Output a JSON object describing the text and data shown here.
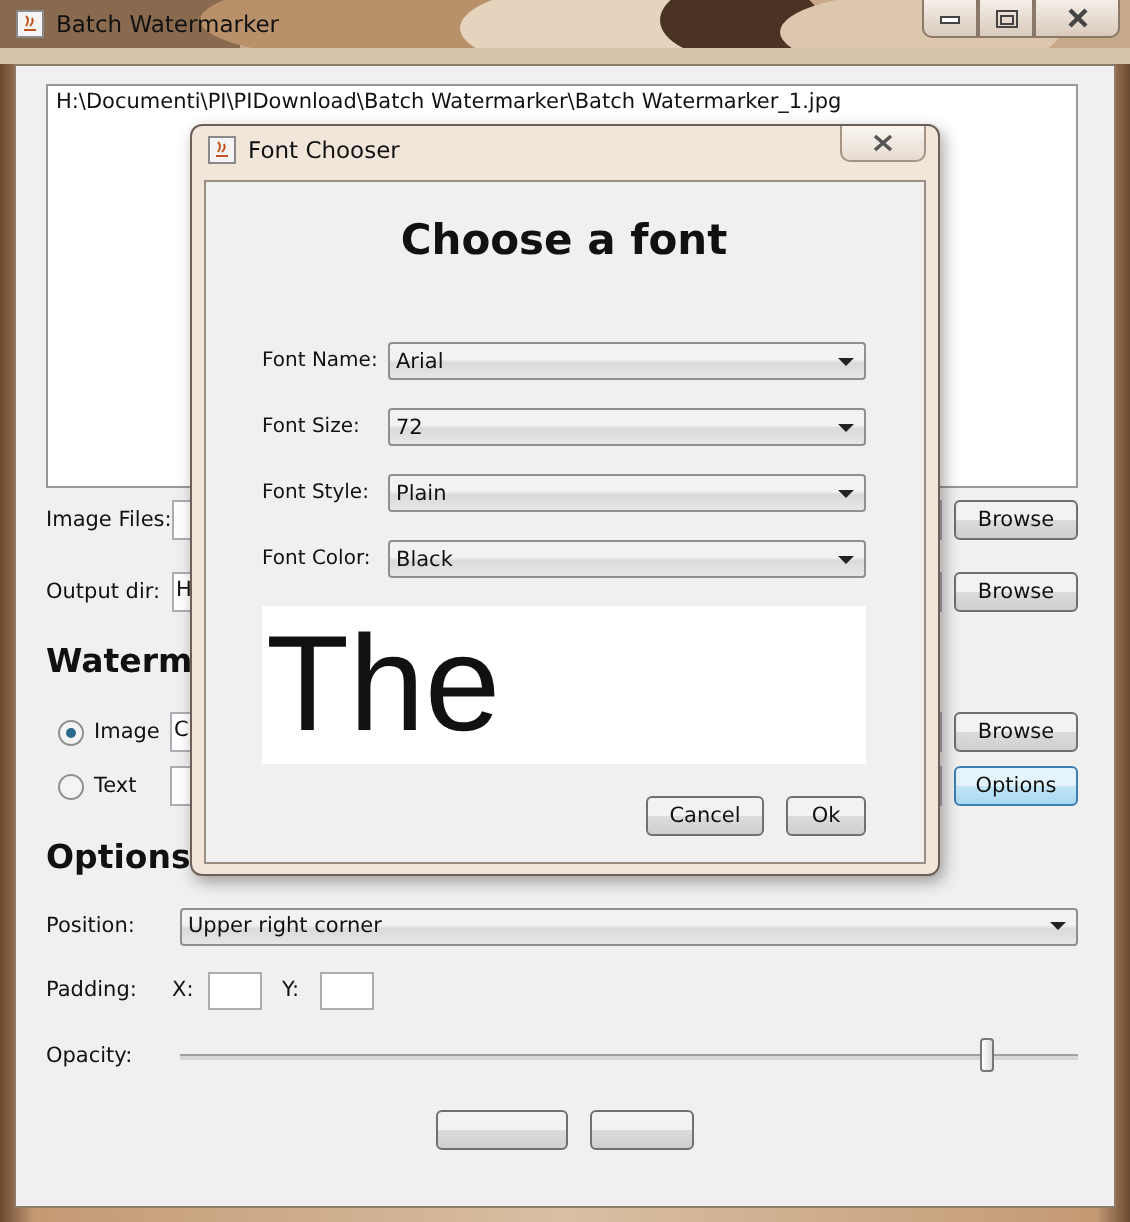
{
  "window": {
    "title": "Batch Watermarker"
  },
  "file_list": {
    "items": [
      "H:\\Documenti\\PI\\PIDownload\\Batch Watermarker\\Batch Watermarker_1.jpg"
    ]
  },
  "image_files": {
    "label": "Image Files:",
    "button": "Browse"
  },
  "output_dir": {
    "label": "Output dir:",
    "value": "H",
    "button": "Browse"
  },
  "watermark_heading": "Waterm",
  "watermark_types": [
    {
      "label": "Image",
      "selected": true,
      "value": "C",
      "button": "Browse",
      "button_focused": false
    },
    {
      "label": "Text",
      "selected": false,
      "button": "Options",
      "button_focused": true
    }
  ],
  "options_heading": "Options",
  "position": {
    "label": "Position:",
    "value": "Upper right corner"
  },
  "padding": {
    "label": "Padding:",
    "x_label": "X:",
    "y_label": "Y:"
  },
  "opacity": {
    "label": "Opacity:",
    "level": 0.9
  },
  "dialog": {
    "title": "Font Chooser",
    "heading": "Choose a font",
    "fields": [
      {
        "label": "Font Name:",
        "value": "Arial"
      },
      {
        "label": "Font Size:",
        "value": "72"
      },
      {
        "label": "Font Style:",
        "value": "Plain"
      },
      {
        "label": "Font Color:",
        "value": "Black"
      }
    ],
    "preview": "The",
    "buttons": [
      "Cancel",
      "Ok"
    ]
  }
}
